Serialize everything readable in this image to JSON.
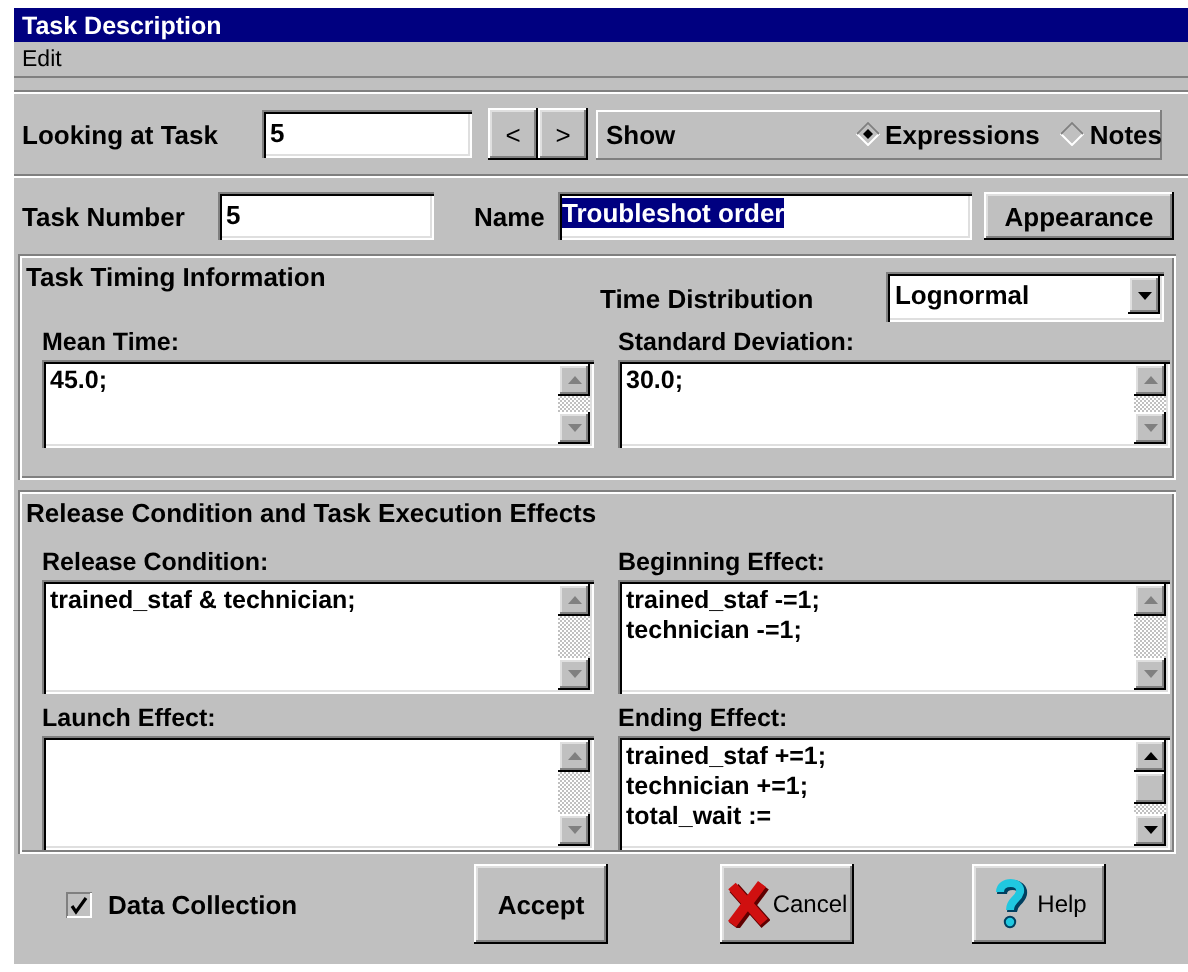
{
  "window": {
    "title": "Task Description"
  },
  "menu": [
    {
      "label": "Edit"
    }
  ],
  "navigator": {
    "label": "Looking at Task",
    "value": "5",
    "prev": "<",
    "next": ">",
    "show_label": "Show",
    "options": [
      {
        "label": "Expressions",
        "selected": true
      },
      {
        "label": "Notes",
        "selected": false
      }
    ]
  },
  "task": {
    "number_label": "Task Number",
    "number": "5",
    "name_label": "Name",
    "name": "Troubleshot order",
    "name_selected": true,
    "appearance_button": "Appearance"
  },
  "timing": {
    "title": "Task Timing Information",
    "distribution_label": "Time Distribution",
    "distribution": "Lognormal",
    "fields": [
      {
        "label": "Mean Time:",
        "lines": [
          "45.0;"
        ],
        "scrollable": false
      },
      {
        "label": "Standard Deviation:",
        "lines": [
          "30.0;"
        ],
        "scrollable": false
      }
    ]
  },
  "effects": {
    "title": "Release Condition and Task Execution Effects",
    "fields": [
      {
        "label": "Release Condition:",
        "lines": [
          "trained_staf & technician;"
        ],
        "scrollable": false
      },
      {
        "label": "Beginning Effect:",
        "lines": [
          "trained_staf -=1;",
          "technician -=1;"
        ],
        "scrollable": false
      },
      {
        "label": "Launch Effect:",
        "scrollable": false
      },
      {
        "label": "Ending Effect:",
        "lines": [
          "trained_staf +=1;",
          "technician +=1;",
          "total_wait :="
        ],
        "scrollable": true
      }
    ]
  },
  "data_collection": {
    "label": "Data Collection",
    "checked": true
  },
  "buttons": [
    {
      "kind": "accept",
      "label": "Accept"
    },
    {
      "kind": "cancel",
      "label": "Cancel"
    },
    {
      "kind": "help",
      "label": "Help"
    }
  ]
}
